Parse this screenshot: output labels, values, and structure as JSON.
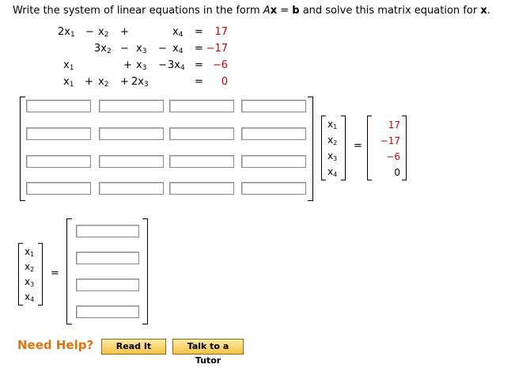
{
  "prompt": {
    "pre": "Write the system of linear equations in the form ",
    "A": "A",
    "x1": "x",
    "eq": " = ",
    "b": "b",
    "mid": " and solve this matrix equation for ",
    "x2": "x",
    "end": "."
  },
  "system": {
    "rows": [
      {
        "terms": [
          "2x",
          "−",
          "x",
          "+",
          "x",
          "=",
          "17"
        ]
      },
      {
        "terms": [
          "3x",
          "−",
          "x",
          "−",
          "x",
          "=",
          "−17"
        ]
      },
      {
        "terms": [
          "x",
          "+",
          "x",
          "−",
          "3x",
          "=",
          "−6"
        ]
      },
      {
        "terms": [
          "x",
          "+",
          "x",
          "+",
          "2x",
          "=",
          "0"
        ]
      }
    ]
  },
  "right_vector": [
    "17",
    "−17",
    "−6",
    "0"
  ],
  "var_labels": [
    "x",
    "x",
    "x",
    "x"
  ],
  "var_subs": [
    "1",
    "2",
    "3",
    "4"
  ],
  "equals": "=",
  "help": {
    "need_help": "Need Help?",
    "read_it": "Read It",
    "talk_tutor": "Talk to a Tutor"
  }
}
